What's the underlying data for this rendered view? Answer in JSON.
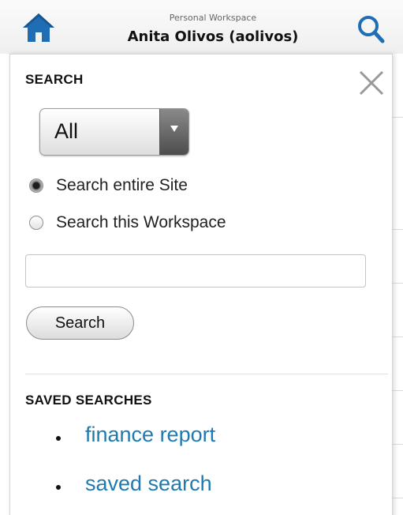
{
  "header": {
    "workspace_label": "Personal Workspace",
    "user_display": "Anita Olivos (aolivos)",
    "home_icon": "home-icon",
    "search_icon": "search-icon"
  },
  "search_panel": {
    "title": "SEARCH",
    "close_icon": "close-icon",
    "scope_select": {
      "selected": "All"
    },
    "scope_options": [
      {
        "label": "Search entire Site",
        "checked": true
      },
      {
        "label": "Search this Workspace",
        "checked": false
      }
    ],
    "query": {
      "value": "",
      "placeholder": ""
    },
    "search_button_label": "Search"
  },
  "saved_searches": {
    "title": "SAVED SEARCHES",
    "items": [
      {
        "label": "finance report"
      },
      {
        "label": "saved search"
      }
    ]
  },
  "colors": {
    "accent_blue": "#1f6db5",
    "link_blue": "#1f7ab0",
    "close_gray": "#9a9a9a"
  }
}
